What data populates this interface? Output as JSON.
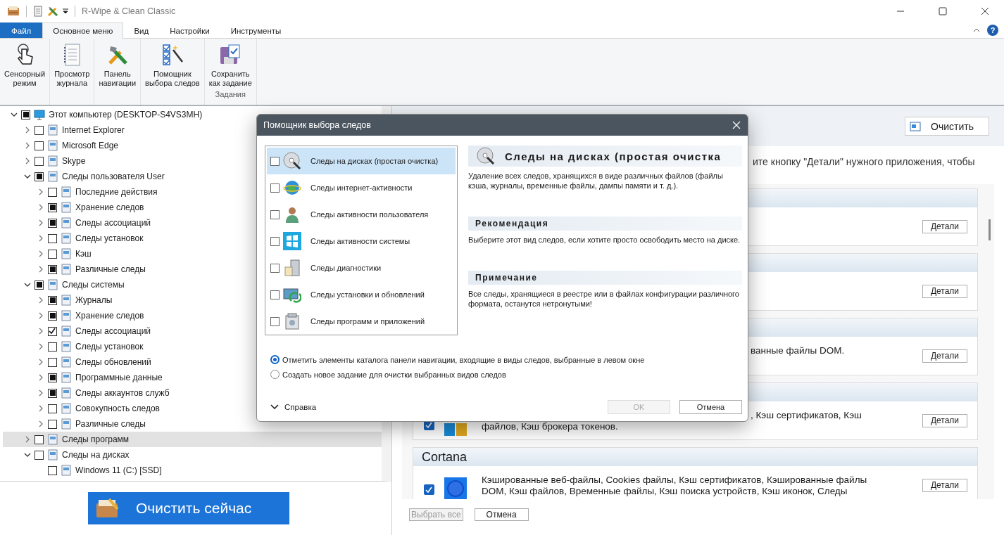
{
  "window": {
    "title": "R-Wipe & Clean Classic"
  },
  "ribbon": {
    "tabs": [
      {
        "label": "Файл",
        "kind": "file",
        "selected": false
      },
      {
        "label": "Основное меню",
        "kind": "tab",
        "selected": true
      },
      {
        "label": "Вид",
        "kind": "tab",
        "selected": false
      },
      {
        "label": "Настройки",
        "kind": "tab",
        "selected": false
      },
      {
        "label": "Инструменты",
        "kind": "tab",
        "selected": false
      }
    ],
    "groups": [
      {
        "buttons": [
          {
            "label": "Сенсорный\nрежим"
          }
        ]
      },
      {
        "buttons": [
          {
            "label": "Просмотр\nжурнала"
          }
        ]
      },
      {
        "buttons": [
          {
            "label": "Панель\nнавигации"
          }
        ]
      },
      {
        "buttons": [
          {
            "label": "Помощник\nвыбора следов"
          }
        ]
      },
      {
        "label": "Задания",
        "buttons": [
          {
            "label": "Сохранить\nкак задание"
          }
        ]
      }
    ],
    "help": "?"
  },
  "tree": [
    {
      "label": "Этот компьютер (DESKTOP-S4VS3MH)",
      "checked": false,
      "partial": true,
      "expanded": true,
      "selected": false,
      "children": [
        {
          "label": "Internet Explorer",
          "checked": false,
          "partial": false,
          "expanded": false,
          "selected": false
        },
        {
          "label": "Microsoft Edge",
          "checked": false,
          "partial": false,
          "expanded": false,
          "selected": false
        },
        {
          "label": "Skype",
          "checked": false,
          "partial": false,
          "expanded": false,
          "selected": false
        },
        {
          "label": "Следы пользователя User",
          "checked": false,
          "partial": true,
          "expanded": true,
          "selected": false,
          "children": [
            {
              "label": "Последние действия",
              "checked": false,
              "partial": false,
              "expanded": false,
              "selected": false
            },
            {
              "label": "Хранение следов",
              "checked": false,
              "partial": true,
              "expanded": false,
              "selected": false
            },
            {
              "label": "Следы ассоциаций",
              "checked": false,
              "partial": true,
              "expanded": false,
              "selected": false
            },
            {
              "label": "Следы установок",
              "checked": false,
              "partial": false,
              "expanded": false,
              "selected": false
            },
            {
              "label": "Кэш",
              "checked": false,
              "partial": false,
              "expanded": false,
              "selected": false
            },
            {
              "label": "Различные следы",
              "checked": false,
              "partial": true,
              "expanded": false,
              "selected": false
            }
          ]
        },
        {
          "label": "Следы системы",
          "checked": false,
          "partial": true,
          "expanded": true,
          "selected": false,
          "children": [
            {
              "label": "Журналы",
              "checked": false,
              "partial": true,
              "expanded": false,
              "selected": false
            },
            {
              "label": "Хранение следов",
              "checked": false,
              "partial": true,
              "expanded": false,
              "selected": false
            },
            {
              "label": "Следы ассоциаций",
              "checked": true,
              "partial": false,
              "expanded": false,
              "selected": false
            },
            {
              "label": "Следы установок",
              "checked": false,
              "partial": false,
              "expanded": false,
              "selected": false
            },
            {
              "label": "Следы обновлений",
              "checked": false,
              "partial": false,
              "expanded": false,
              "selected": false
            },
            {
              "label": "Программные данные",
              "checked": false,
              "partial": true,
              "expanded": false,
              "selected": false
            },
            {
              "label": "Следы аккаунтов служб",
              "checked": false,
              "partial": true,
              "expanded": false,
              "selected": false
            },
            {
              "label": "Совокупность следов",
              "checked": false,
              "partial": false,
              "expanded": false,
              "selected": false
            },
            {
              "label": "Различные следы",
              "checked": false,
              "partial": false,
              "expanded": false,
              "selected": false
            }
          ]
        },
        {
          "label": "Следы программ",
          "checked": false,
          "partial": false,
          "expanded": false,
          "selected": true
        },
        {
          "label": "Следы на дисках",
          "checked": false,
          "partial": false,
          "expanded": true,
          "selected": false,
          "children": [
            {
              "label": "Windows 11 (C:) [SSD]",
              "checked": false,
              "partial": false,
              "selected": false
            }
          ]
        }
      ]
    }
  ],
  "clean_now": "Очистить сейчас",
  "right_panel": {
    "clean_button": "Очистить",
    "hint": "ите кнопку \"Детали\" нужного приложения, чтобы",
    "cards": [
      {
        "details": "Детали"
      },
      {
        "details": "Детали"
      },
      {
        "details": "Детали",
        "lines": [
          {
            "text": "ванные файлы DOM.",
            "covered": true
          }
        ]
      },
      {
        "details": "Детали",
        "checked": true,
        "lines": [
          {
            "text": ", Кэш сертификатов, Кэш",
            "covered": true
          },
          {
            "text": "файлов, Кэш брокера токенов.",
            "covered": false
          }
        ]
      },
      {
        "title": "Cortana",
        "details": "Детали",
        "checked": true,
        "lines": [
          {
            "text": "Кэшированные веб-файлы, Cookies файлы, Кэш сертификатов, Кэшированные файлы",
            "covered": false
          },
          {
            "text": "DOM, Кэш файлов, Временные файлы, Кэш поиска устройств, Кэш иконок, Следы",
            "covered": false
          }
        ]
      }
    ],
    "select_all": {
      "label": "Выбрать все",
      "disabled": true
    },
    "cancel": "Отмена"
  },
  "dialog": {
    "title": "Помощник выбора следов",
    "items": [
      {
        "label": "Следы на дисках (простая очистка)",
        "checked": false,
        "selected": true
      },
      {
        "label": "Следы интернет-активности",
        "checked": false,
        "selected": false
      },
      {
        "label": "Следы активности пользователя",
        "checked": false,
        "selected": false
      },
      {
        "label": "Следы активности системы",
        "checked": false,
        "selected": false
      },
      {
        "label": "Следы диагностики",
        "checked": false,
        "selected": false
      },
      {
        "label": "Следы установки и обновлений",
        "checked": false,
        "selected": false
      },
      {
        "label": "Следы программ и приложений",
        "checked": false,
        "selected": false
      }
    ],
    "detail": {
      "heading": "Следы на дисках (простая очистка",
      "description": "Удаление всех следов, хранящихся в виде различных файлов (файлы кэша, журналы, временные файлы, дампы памяти и т. д.).",
      "sections": [
        {
          "heading": "Рекомендация",
          "text": "Выберите этот вид следов, если хотите просто освободить место на диске."
        },
        {
          "heading": "Примечание",
          "text": "Все следы, хранящиеся в реестре или в файлах конфигурации различного формата, останутся нетронутыми!"
        }
      ]
    },
    "options": [
      {
        "label": "Отметить элементы каталога панели навигации, входящие в виды следов, выбранные в левом окне",
        "selected": true
      },
      {
        "label": "Создать новое задание для очистки выбранных видов следов",
        "selected": false
      }
    ],
    "help": "Справка",
    "ok": {
      "label": "OK",
      "disabled": true
    },
    "cancel": "Отмена"
  }
}
